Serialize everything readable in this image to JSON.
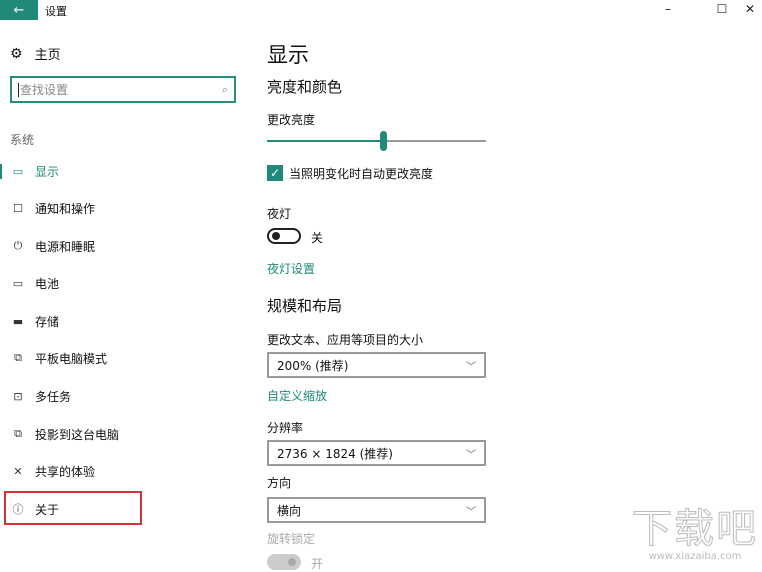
{
  "window": {
    "title": "设置",
    "back_icon": "←",
    "minimize": "–",
    "maximize": "☐",
    "close": "✕"
  },
  "sidebar": {
    "home": "主页",
    "search_placeholder": "查找设置",
    "section": "系统",
    "items": [
      {
        "label": "显示",
        "icon": "▭"
      },
      {
        "label": "通知和操作",
        "icon": "☐"
      },
      {
        "label": "电源和睡眠",
        "icon": "⏻"
      },
      {
        "label": "电池",
        "icon": "▭"
      },
      {
        "label": "存储",
        "icon": "▬"
      },
      {
        "label": "平板电脑模式",
        "icon": "⧉"
      },
      {
        "label": "多任务",
        "icon": "⊡"
      },
      {
        "label": "投影到这台电脑",
        "icon": "⧉"
      },
      {
        "label": "共享的体验",
        "icon": "✕"
      },
      {
        "label": "关于",
        "icon": "ⓘ"
      }
    ]
  },
  "main": {
    "title": "显示",
    "brightness_section": "亮度和颜色",
    "brightness_label": "更改亮度",
    "brightness_value": 53,
    "auto_brightness_label": "当照明变化时自动更改亮度",
    "auto_brightness_checked": true,
    "night_light_label": "夜灯",
    "night_light_state": "关",
    "night_light_settings": "夜灯设置",
    "scale_section": "规模和布局",
    "scale_label": "更改文本、应用等项目的大小",
    "scale_value": "200% (推荐)",
    "custom_scaling": "自定义缩放",
    "resolution_label": "分辨率",
    "resolution_value": "2736 × 1824 (推荐)",
    "orientation_label": "方向",
    "orientation_value": "横向",
    "rotation_lock_label": "旋转锁定",
    "rotation_lock_state": "开"
  },
  "watermark": {
    "logo": "下载吧",
    "url": "www.xiazaiba.com"
  },
  "colors": {
    "accent": "#1f8a78",
    "highlight": "#d0343a"
  }
}
